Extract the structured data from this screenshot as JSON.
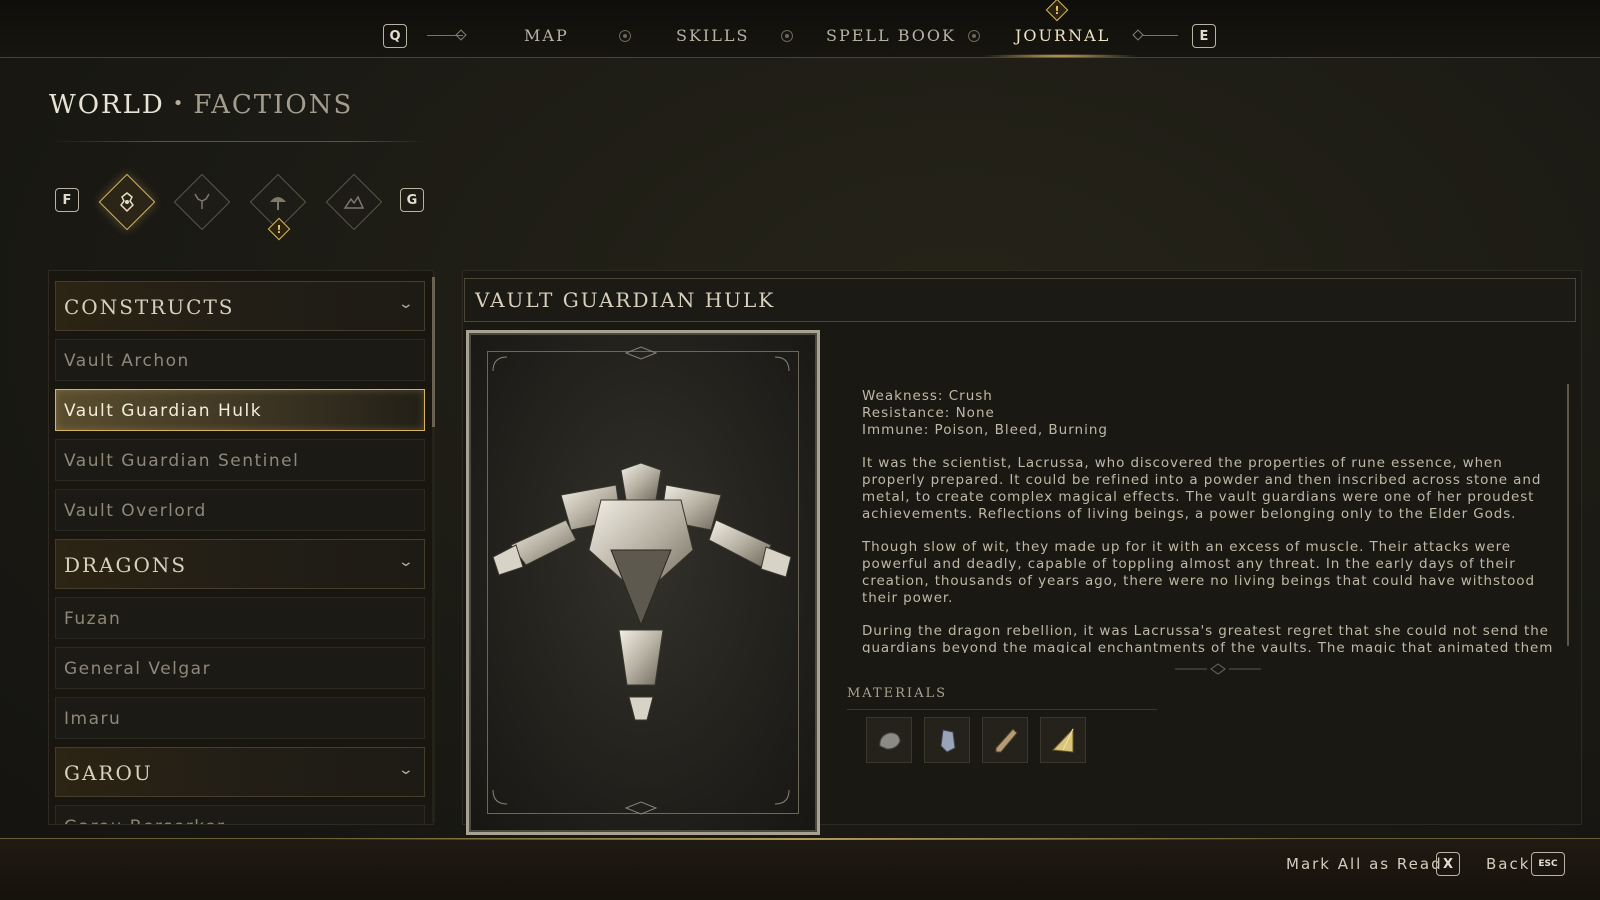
{
  "nav": {
    "left_key": "Q",
    "right_key": "E",
    "tabs": [
      {
        "label": "MAP",
        "active": false
      },
      {
        "label": "SKILLS",
        "active": false
      },
      {
        "label": "SPELL BOOK",
        "active": false
      },
      {
        "label": "JOURNAL",
        "active": true
      }
    ],
    "alert_glyph": "!"
  },
  "header": {
    "section": "WORLD",
    "separator": "•",
    "subsection": "FACTIONS"
  },
  "categories": {
    "prev_key": "F",
    "next_key": "G",
    "icons": [
      {
        "icon": "construct-faction-icon",
        "active": true
      },
      {
        "icon": "stag-faction-icon",
        "active": false
      },
      {
        "icon": "tree-faction-icon",
        "active": false,
        "alert": true
      },
      {
        "icon": "mountain-faction-icon",
        "active": false
      }
    ],
    "alert_glyph": "!"
  },
  "list": {
    "sections": [
      {
        "label": "CONSTRUCTS",
        "items": [
          "Vault Archon",
          "Vault Guardian Hulk",
          "Vault Guardian Sentinel",
          "Vault Overlord"
        ]
      },
      {
        "label": "DRAGONS",
        "items": [
          "Fuzan",
          "General Velgar",
          "Imaru"
        ]
      },
      {
        "label": "GAROU",
        "items": [
          "Garou Berserker"
        ]
      }
    ],
    "selected": "Vault Guardian Hulk",
    "chevron_icon": "chevron-down-icon"
  },
  "detail": {
    "title": "VAULT GUARDIAN HULK",
    "weakness": "Weakness: Crush",
    "resistance": "Resistance: None",
    "immune": "Immune: Poison, Bleed, Burning",
    "paragraphs": [
      "It was the scientist, Lacrussa, who discovered the properties of rune essence, when properly prepared. It could be refined into a powder and then inscribed across stone and metal, to create complex magical effects. The vault guardians were one of her proudest achievements. Reflections of living beings, a power belonging only to the Elder Gods.",
      "Though slow of wit, they made up for it with an excess of muscle. Their attacks were powerful and deadly, capable of toppling almost any threat. In the early days of their creation, thousands of years ago, there were no living beings that could have withstood their power.",
      "During the dragon rebellion, it was Lacrussa's greatest regret that she could not send the guardians beyond the magical enchantments of the vaults. The magic that animated them only worked within those walls, and dragons had no need of dragonkin secrets."
    ],
    "materials_label": "MATERIALS",
    "materials": [
      "stone-material-icon",
      "crystal-material-icon",
      "shard-material-icon",
      "gold-shard-material-icon"
    ]
  },
  "footer": {
    "mark_all_label": "Mark All as Read",
    "mark_all_key": "X",
    "back_label": "Back",
    "back_key": "ESC"
  }
}
